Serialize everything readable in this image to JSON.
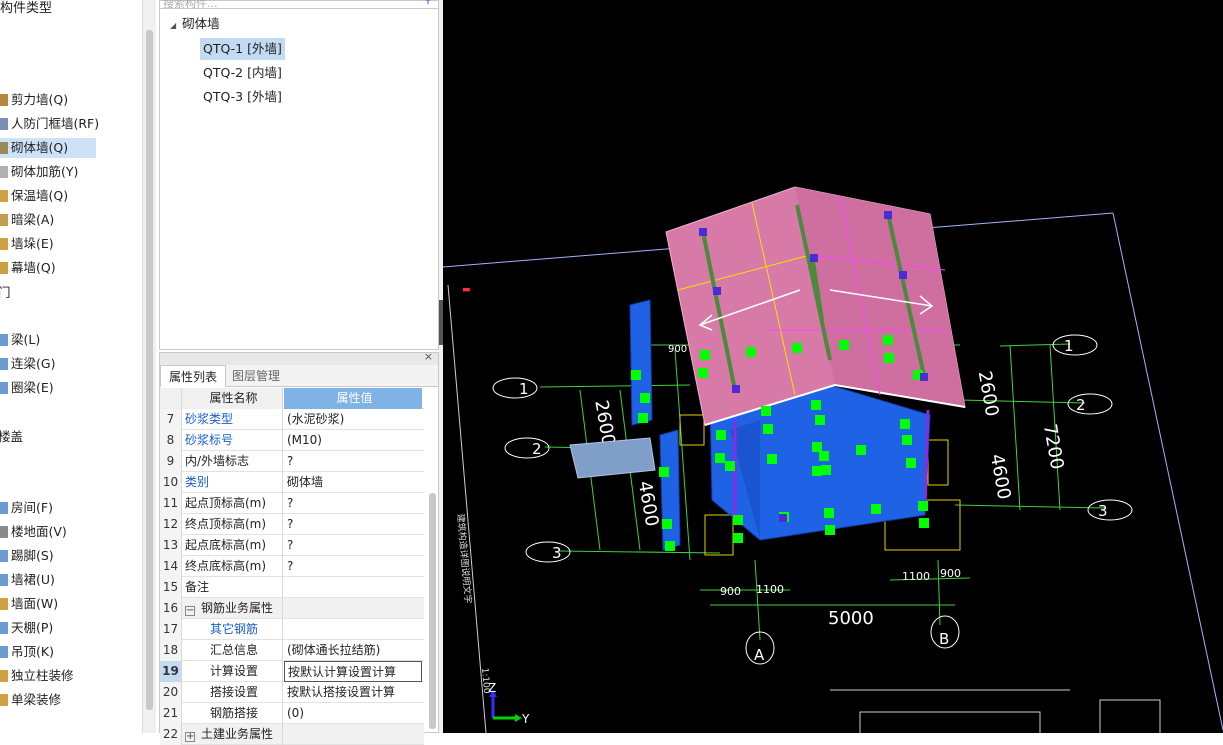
{
  "left_panel": {
    "header": "构件类型",
    "items": [
      {
        "label": "剪力墙(Q)",
        "icon_color": "#b58a3a"
      },
      {
        "label": "人防门框墙(RF)",
        "icon_color": "#7a8fb5"
      },
      {
        "label": "砌体墙(Q)",
        "icon_color": "#9a8a5a",
        "selected": true
      },
      {
        "label": "砌体加筋(Y)",
        "icon_color": "#b0b0b0"
      },
      {
        "label": "保温墙(Q)",
        "icon_color": "#d0a040"
      },
      {
        "label": "暗梁(A)",
        "icon_color": "#c0a050"
      },
      {
        "label": "墙垛(E)",
        "icon_color": "#d0a040"
      },
      {
        "label": "幕墙(Q)",
        "icon_color": "#c8a040"
      },
      {
        "label": "梁(L)",
        "icon_color": "#6a9ad0"
      },
      {
        "label": "连梁(G)",
        "icon_color": "#6a9ad0"
      },
      {
        "label": "圈梁(E)",
        "icon_color": "#6a9ad0"
      },
      {
        "label": "房间(F)",
        "icon_color": "#6a9ad0"
      },
      {
        "label": "楼地面(V)",
        "icon_color": "#8a8a8a"
      },
      {
        "label": "踢脚(S)",
        "icon_color": "#6a9ad0"
      },
      {
        "label": "墙裙(U)",
        "icon_color": "#6a9ad0"
      },
      {
        "label": "墙面(W)",
        "icon_color": "#d0a040"
      },
      {
        "label": "天棚(P)",
        "icon_color": "#6a9ad0"
      },
      {
        "label": "吊顶(K)",
        "icon_color": "#6a9ad0"
      },
      {
        "label": "独立柱装修",
        "icon_color": "#d0a040"
      },
      {
        "label": "单梁装修",
        "icon_color": "#d0a040"
      }
    ],
    "groups": [
      "门",
      "楼盖"
    ]
  },
  "tree": {
    "search_placeholder": "搜索构件...",
    "root": "砌体墙",
    "nodes": [
      "QTQ-1 [外墙]",
      "QTQ-2 [内墙]",
      "QTQ-3 [外墙]"
    ]
  },
  "props": {
    "tabs": [
      "属性列表",
      "图层管理"
    ],
    "header": {
      "name": "属性名称",
      "value": "属性值"
    },
    "rows": [
      {
        "n": "7",
        "name": "砂浆类型",
        "value": "(水泥砂浆)",
        "blue": true
      },
      {
        "n": "8",
        "name": "砂浆标号",
        "value": "(M10)",
        "blue": true
      },
      {
        "n": "9",
        "name": "内/外墙标志",
        "value": "?"
      },
      {
        "n": "10",
        "name": "类别",
        "value": "砌体墙",
        "blue": true
      },
      {
        "n": "11",
        "name": "起点顶标高(m)",
        "value": "?"
      },
      {
        "n": "12",
        "name": "终点顶标高(m)",
        "value": "?"
      },
      {
        "n": "13",
        "name": "起点底标高(m)",
        "value": "?"
      },
      {
        "n": "14",
        "name": "终点底标高(m)",
        "value": "?"
      },
      {
        "n": "15",
        "name": "备注",
        "value": ""
      },
      {
        "n": "16",
        "name": "钢筋业务属性",
        "value": "",
        "group": true,
        "expander": "−"
      },
      {
        "n": "17",
        "name": "其它钢筋",
        "value": "",
        "blue": true,
        "indent": true
      },
      {
        "n": "18",
        "name": "汇总信息",
        "value": "(砌体通长拉结筋)",
        "indent": true
      },
      {
        "n": "19",
        "name": "计算设置",
        "value": "按默认计算设置计算",
        "indent": true,
        "current": true
      },
      {
        "n": "20",
        "name": "搭接设置",
        "value": "按默认搭接设置计算",
        "indent": true
      },
      {
        "n": "21",
        "name": "钢筋搭接",
        "value": "(0)",
        "indent": true
      },
      {
        "n": "22",
        "name": "土建业务属性",
        "value": "",
        "group": true,
        "expander": "+"
      }
    ]
  },
  "cad": {
    "dims": [
      "2600",
      "4600",
      "2600",
      "7200",
      "4600",
      "5000",
      "900",
      "1100",
      "1100",
      "900",
      "900",
      "1100"
    ],
    "axes": [
      "1",
      "2",
      "3",
      "1",
      "2",
      "3",
      "A",
      "B"
    ],
    "axis_indicator": {
      "z": "Z",
      "y": "Y"
    },
    "scale_label": "1:100"
  },
  "colors": {
    "roof": "#d87aa8",
    "wall": "#1f62e6",
    "marker": "#00ff00",
    "grid": "#3fd13f",
    "select": "#7fb3e6"
  }
}
